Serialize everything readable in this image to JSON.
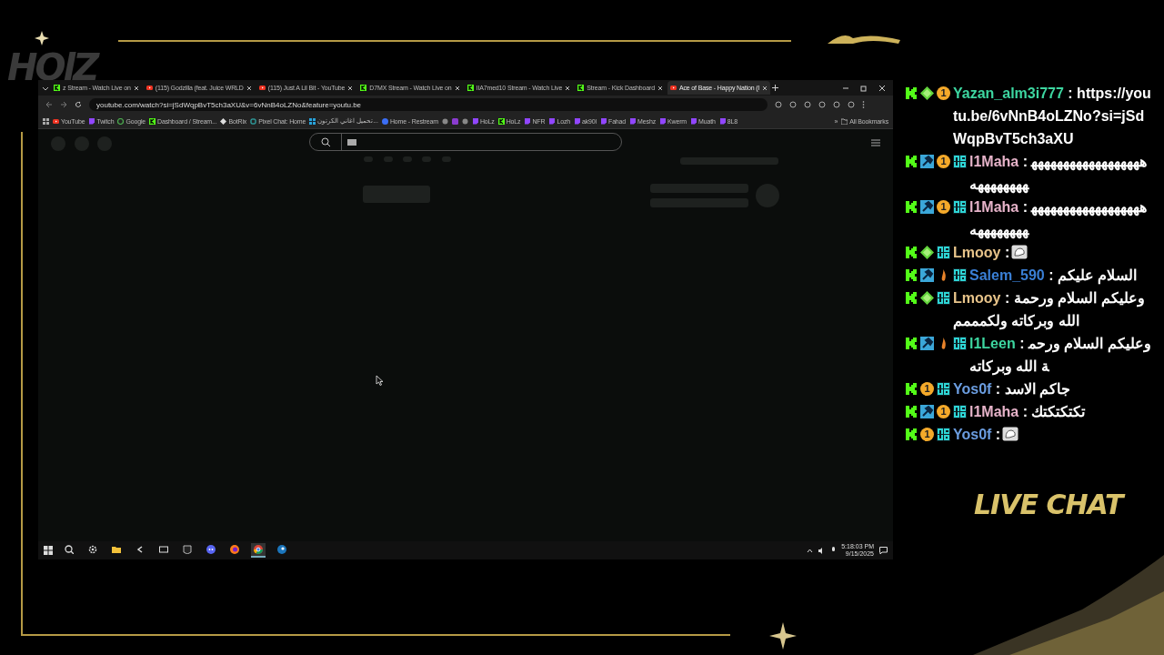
{
  "logo": {
    "text": "HOlZ"
  },
  "browser": {
    "tabs": [
      {
        "title": "z Stream - Watch Live on",
        "kind": "kick",
        "selected": false
      },
      {
        "title": "(115) Godzilla (feat. Juice WRLD",
        "kind": "youtube",
        "selected": false
      },
      {
        "title": "(115) Just A Lil Bit - YouTube",
        "kind": "youtube",
        "selected": false
      },
      {
        "title": "D7MX Stream - Watch Live on",
        "kind": "kick",
        "selected": false
      },
      {
        "title": "IIA7med10 Stream - Watch Live",
        "kind": "kick",
        "selected": false
      },
      {
        "title": "Stream - Kick Dashboard",
        "kind": "kick",
        "selected": false
      },
      {
        "title": "Ace of Base - Happy Nation (l",
        "kind": "youtube",
        "selected": true
      }
    ],
    "url": "youtube.com/watch?si=jSdWqpBvT5ch3aXU&v=6vNnB4oLZNo&feature=youtu.be",
    "bookmarks": [
      {
        "label": "YouTube",
        "kind": "youtube"
      },
      {
        "label": "Twitch",
        "kind": "twitch"
      },
      {
        "label": "Google",
        "kind": "google"
      },
      {
        "label": "Dashboard / Stream...",
        "kind": "kick"
      },
      {
        "label": "BotRix",
        "kind": "diamond"
      },
      {
        "label": "Pixel Chat: Home",
        "kind": "pixel"
      },
      {
        "label": "تحميل اغاني الكرتون...",
        "kind": "grid"
      },
      {
        "label": "Home - Restream",
        "kind": "restream"
      },
      {
        "kind": "globe"
      },
      {
        "kind": "badge"
      },
      {
        "kind": "globe"
      },
      {
        "label": "HoLz",
        "kind": "twitch"
      },
      {
        "label": "HoLz",
        "kind": "kick"
      },
      {
        "label": "NFR",
        "kind": "twitch"
      },
      {
        "label": "Lozh",
        "kind": "twitch"
      },
      {
        "label": "ak90l",
        "kind": "twitch"
      },
      {
        "label": "Fahad",
        "kind": "twitch"
      },
      {
        "label": "Meshz",
        "kind": "twitch"
      },
      {
        "label": "Kwerm",
        "kind": "twitch"
      },
      {
        "label": "Muath",
        "kind": "twitch"
      },
      {
        "label": "8L8",
        "kind": "twitch"
      }
    ],
    "more_bookmarks": "»",
    "all_bookmarks": "All Bookmarks"
  },
  "taskbar": {
    "apps": [
      {
        "kind": "search",
        "active": false
      },
      {
        "kind": "gear",
        "active": false
      },
      {
        "kind": "folder",
        "active": false
      },
      {
        "kind": "back",
        "active": false
      },
      {
        "kind": "window",
        "active": false
      },
      {
        "kind": "epic",
        "active": false
      },
      {
        "kind": "discord",
        "active": false
      },
      {
        "kind": "firefox",
        "active": false
      },
      {
        "kind": "chrome",
        "active": true
      },
      {
        "kind": "steam",
        "active": false
      }
    ],
    "time": "5:18:03 PM",
    "date": "9/15/2025"
  },
  "chat": {
    "messages": [
      {
        "user": "Yazan_alm3i777",
        "color": "#3dd6a0",
        "badges": [
          {
            "kind": "kick"
          },
          {
            "kind": "gem"
          },
          {
            "kind": "sub",
            "text": "1"
          }
        ],
        "separator": ":",
        "text": "https://youtu.be/6vNnB4oLZNo?si=jSdWqpBvT5ch3aXU"
      },
      {
        "user": "l1Maha",
        "color": "#e6b3c9",
        "badges": [
          {
            "kind": "kick"
          },
          {
            "kind": "mod"
          },
          {
            "kind": "sub",
            "text": "1"
          },
          {
            "kind": "og"
          }
        ],
        "separator": ":",
        "text": "ههههههههههههههههههههههههههه"
      },
      {
        "user": "l1Maha",
        "color": "#e6b3c9",
        "badges": [
          {
            "kind": "kick"
          },
          {
            "kind": "mod"
          },
          {
            "kind": "sub",
            "text": "1"
          },
          {
            "kind": "og"
          }
        ],
        "separator": ":",
        "text": "ههههههههههههههههههههههههههه"
      },
      {
        "user": "Lmooy",
        "color": "#e8c48a",
        "badges": [
          {
            "kind": "kick"
          },
          {
            "kind": "gem"
          },
          {
            "kind": "og"
          }
        ],
        "separator": ":",
        "emote": true
      },
      {
        "user": "Salem_590",
        "color": "#3a7fd5",
        "badges": [
          {
            "kind": "kick"
          },
          {
            "kind": "mod"
          },
          {
            "kind": "flame"
          },
          {
            "kind": "og"
          }
        ],
        "separator": ":",
        "text": "السلام عليكم"
      },
      {
        "user": "Lmooy",
        "color": "#e8c48a",
        "badges": [
          {
            "kind": "kick"
          },
          {
            "kind": "gem"
          },
          {
            "kind": "og"
          }
        ],
        "separator": ":",
        "text": "وعليكم السلام ورحمة الله وبركاته ولكمممم"
      },
      {
        "user": "l1Leen",
        "color": "#3dd6a0",
        "badges": [
          {
            "kind": "kick"
          },
          {
            "kind": "mod"
          },
          {
            "kind": "flame"
          },
          {
            "kind": "og"
          }
        ],
        "separator": ":",
        "text": "وعليكم السلام ورحمة الله وبركاته"
      },
      {
        "user": "Yos0f",
        "color": "#6b9de0",
        "badges": [
          {
            "kind": "kick"
          },
          {
            "kind": "sub",
            "text": "1"
          },
          {
            "kind": "og"
          }
        ],
        "separator": ":",
        "text": "جاكم الاسد"
      },
      {
        "user": "l1Maha",
        "color": "#e6b3c9",
        "badges": [
          {
            "kind": "kick"
          },
          {
            "kind": "mod"
          },
          {
            "kind": "sub",
            "text": "1"
          },
          {
            "kind": "og"
          }
        ],
        "separator": ":",
        "text": "تكتكتكتك"
      },
      {
        "user": "Yos0f",
        "color": "#6b9de0",
        "badges": [
          {
            "kind": "kick"
          },
          {
            "kind": "sub",
            "text": "1"
          },
          {
            "kind": "og"
          }
        ],
        "separator": ":",
        "emote": true
      }
    ],
    "label": "LIVE CHAT"
  }
}
